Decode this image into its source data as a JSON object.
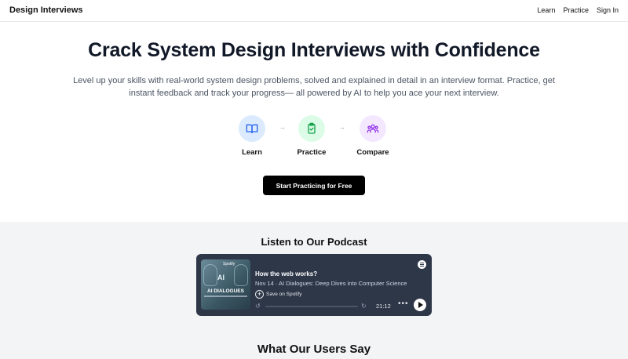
{
  "nav": {
    "brand": "Design Interviews",
    "links": [
      "Learn",
      "Practice",
      "Sign In"
    ]
  },
  "hero": {
    "title": "Crack System Design Interviews with Confidence",
    "subtitle": "Level up your skills with real-world system design problems, solved and explained in detail in an interview format. Practice, get instant feedback and track your progress— all powered by AI to help you ace your next interview.",
    "steps": [
      {
        "label": "Learn",
        "icon": "book-icon",
        "color": "#2563eb"
      },
      {
        "label": "Practice",
        "icon": "clipboard-check-icon",
        "color": "#16a34a"
      },
      {
        "label": "Compare",
        "icon": "users-icon",
        "color": "#9333ea"
      }
    ],
    "cta_label": "Start Practicing for Free"
  },
  "podcast": {
    "section_title": "Listen to Our Podcast",
    "episode_title": "How the web works?",
    "episode_meta": "Nov 14 · AI Dialogues: Deep Dives into Computer Science",
    "save_label": "Save on Spotify",
    "duration": "21:12",
    "progress": 0,
    "cover": {
      "ai": "AI",
      "name": "AI DIALOGUES",
      "brand": "Spotify"
    }
  },
  "testimonials": {
    "section_title": "What Our Users Say"
  },
  "colors": {
    "cta_bg": "#000000",
    "player_bg": "#2d3748",
    "section_bg": "#f3f4f6"
  }
}
